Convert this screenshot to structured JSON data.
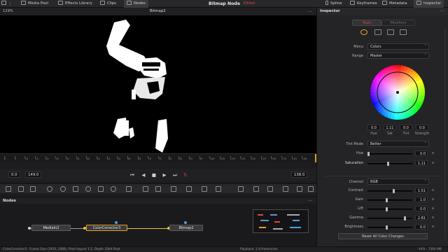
{
  "topbar": {
    "media_pool": "Media Pool",
    "effects_library": "Effects Library",
    "clips": "Clips",
    "nodes": "Nodes",
    "title": "Bitmap Node",
    "edited": "Edited",
    "spline": "Spline",
    "keyframes": "Keyframes",
    "metadata": "Metadata",
    "inspector": "Inspector"
  },
  "viewer": {
    "zoom": "129%",
    "name": "Bitmap2",
    "menu_glyph": "…"
  },
  "ruler": {
    "ticks": [
      "0",
      "5",
      "10",
      "15",
      "20",
      "25",
      "30",
      "35",
      "40",
      "45",
      "50",
      "55",
      "60",
      "65",
      "70",
      "75",
      "80",
      "85",
      "90",
      "95",
      "100",
      "105",
      "110",
      "115",
      "120",
      "125",
      "130",
      "135",
      "140",
      "145"
    ]
  },
  "transport": {
    "start": "0.0",
    "end": "149.0",
    "current": "138.0",
    "btn_first": "⏮",
    "btn_back": "◀",
    "btn_stop": "■",
    "btn_play": "▶",
    "btn_last": "⏭",
    "btn_loop": "↻"
  },
  "nodes": {
    "title": "Nodes",
    "menu_glyph": "…",
    "media_in": "MediaIn2",
    "color_corrector": "ColorCorrector3",
    "bitmap": "Bitmap2"
  },
  "status": {
    "left": "ColorCorrector3 - Frame Size (1920, 1080), Pixel Aspect 1:1, Depth 32bit float",
    "center": "Playback: 1.9 frames/sec",
    "right": "44% - 7264 MB"
  },
  "inspector": {
    "title": "Inspector",
    "menu_glyph": "…",
    "tab_tools": "Tools",
    "tab_modifiers": "Modifiers",
    "menu_label": "Menu",
    "menu_value": "Colors",
    "range_label": "Range",
    "range_value": "Master",
    "chevron": "˅",
    "wheel_values": {
      "hue": "0.0",
      "sat": "1.11",
      "tint": "0.0",
      "strength": "0.0"
    },
    "wheel_labels": {
      "hue": "Hue",
      "sat": "Sat",
      "tint": "Tint",
      "strength": "Strength"
    },
    "tint_mode_label": "Tint Mode",
    "tint_mode_value": "Better",
    "hue_label": "Hue",
    "hue_value": "0.0",
    "saturation_label": "Saturation",
    "saturation_value": "1.11",
    "channel_label": "Channel",
    "channel_value": "RGB",
    "contrast_label": "Contrast",
    "contrast_value": "1.51",
    "gain_label": "Gain",
    "gain_value": "1.0",
    "lift_label": "Lift",
    "lift_value": "0.0",
    "gamma_label": "Gamma",
    "gamma_value": "2.81",
    "brightness_label": "Brightness",
    "brightness_value": "0.0",
    "reset_label": "Reset All Color Changes"
  },
  "colors": {
    "accent_orange": "#e39f2b",
    "accent_red": "#e0453a",
    "link_yellow": "#e8c43a"
  }
}
